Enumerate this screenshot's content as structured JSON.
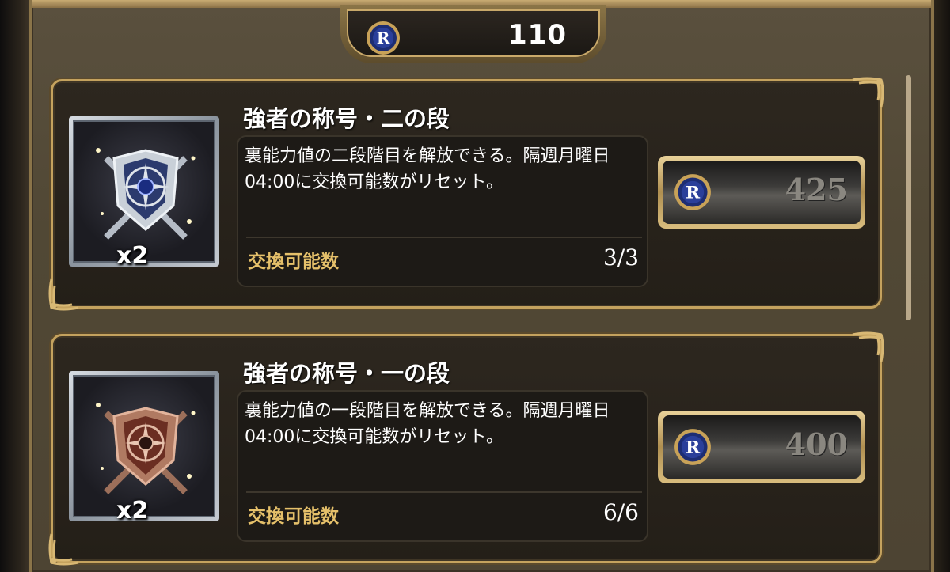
{
  "currency": {
    "icon": "r-medal-coin-icon",
    "amount": "110"
  },
  "items": [
    {
      "title": "強者の称号・二の段",
      "icon": "silver-crest-icon",
      "quantity": "x2",
      "description": "裏能力値の二段階目を解放できる。隔週月曜日04:00に交換可能数がリセット。",
      "limit_label": "交換可能数",
      "limit_value": "3/3",
      "price": "425"
    },
    {
      "title": "強者の称号・一の段",
      "icon": "bronze-crest-icon",
      "quantity": "x2",
      "description": "裏能力値の一段階目を解放できる。隔週月曜日04:00に交換可能数がリセット。",
      "limit_label": "交換可能数",
      "limit_value": "6/6",
      "price": "400"
    }
  ],
  "colors": {
    "gold_border": "#c4a25e",
    "limit_label": "#e5c06a",
    "price_text": "#8a8780"
  }
}
